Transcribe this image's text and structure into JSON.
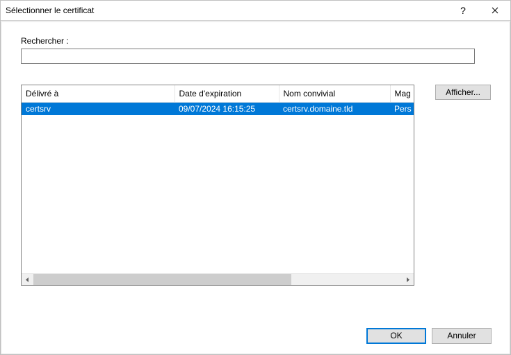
{
  "title": "Sélectionner le certificat",
  "search": {
    "label": "Rechercher :",
    "value": ""
  },
  "table": {
    "headers": [
      "Délivré à",
      "Date d'expiration",
      "Nom convivial",
      "Mag"
    ],
    "rows": [
      {
        "issued_to": "certsrv",
        "expiry": "09/07/2024 16:15:25",
        "friendly": "certsrv.domaine.tld",
        "store": "Pers",
        "selected": true
      }
    ]
  },
  "buttons": {
    "view": "Afficher...",
    "ok": "OK",
    "cancel": "Annuler"
  }
}
